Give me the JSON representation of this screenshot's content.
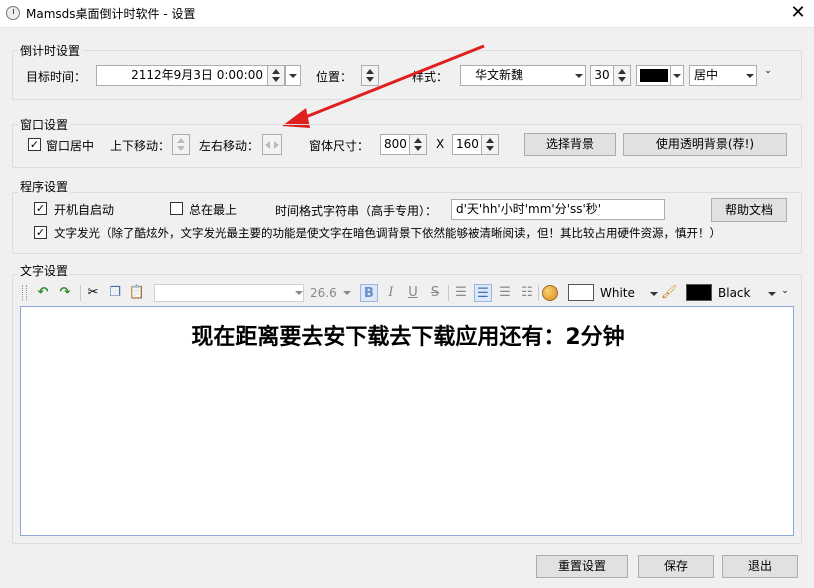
{
  "window": {
    "title": "Mamsds桌面倒计时软件 - 设置",
    "close": "✕"
  },
  "countdown": {
    "label": "倒计时设置",
    "target_label": "目标时间：",
    "target_value": "2112年9月3日 0:00:00",
    "position_label": "位置：",
    "style_label": "样式：",
    "font_value": "华文新魏",
    "size_value": "30",
    "color_value": "#000000",
    "align_value": "居中"
  },
  "window_settings": {
    "label": "窗口设置",
    "center_label": "窗口居中",
    "center_checked": true,
    "updown_label": "上下移动：",
    "leftright_label": "左右移动：",
    "size_label": "窗体尺寸：",
    "width_value": "800",
    "x_label": "X",
    "height_value": "160",
    "choose_bg": "选择背景",
    "transparent_bg": "使用透明背景(荐!)"
  },
  "program": {
    "label": "程序设置",
    "autostart_label": "开机自启动",
    "autostart_checked": true,
    "topmost_label": "总在最上",
    "topmost_checked": false,
    "format_label": "时间格式字符串（高手专用）：",
    "format_value": "d'天'hh'小时'mm'分'ss'秒'",
    "help_button": "帮助文档",
    "glow_label": "文字发光（除了酷炫外，文字发光最主要的功能是使文字在暗色调背景下依然能够被清晰阅读，但！其比较占用硬件资源，慎开！）",
    "glow_checked": true
  },
  "text_settings": {
    "label": "文字设置",
    "font_size": "26.6",
    "fore_color_name": "White",
    "back_color_name": "Black",
    "content": "现在距离要去安下载去下载应用还有：2分钟"
  },
  "footer": {
    "reset": "重置设置",
    "save": "保存",
    "exit": "退出"
  },
  "colors": {
    "accent": "#e0201f",
    "editor_border": "#8aa9d6"
  }
}
